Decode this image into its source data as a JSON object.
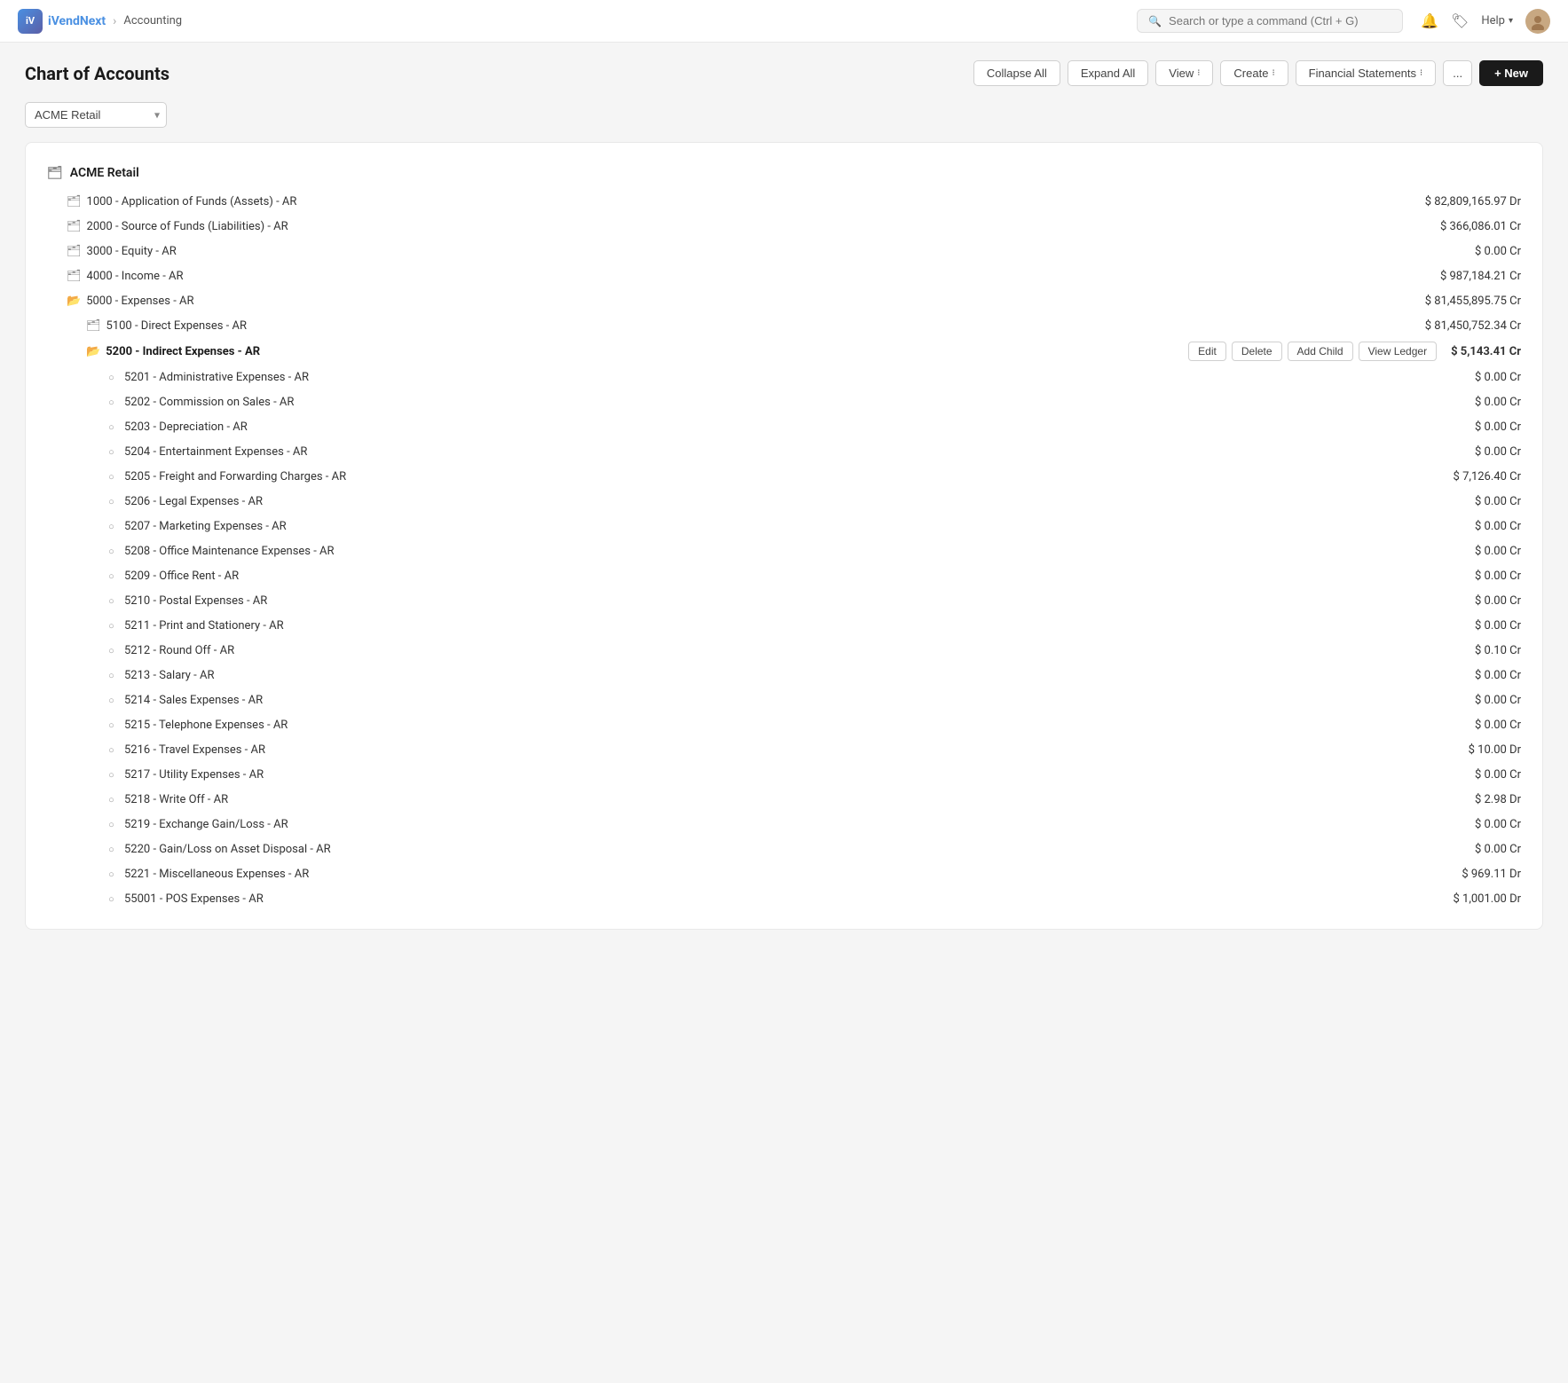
{
  "app": {
    "name": "iVendNext",
    "logo_text": "iV",
    "breadcrumb_separator": "›",
    "section": "Accounting"
  },
  "topnav": {
    "search_placeholder": "Search or type a command (Ctrl + G)",
    "help_label": "Help",
    "notification_icon": "🔔",
    "bookmark_icon": "🏷"
  },
  "page": {
    "title": "Chart of Accounts",
    "collapse_all": "Collapse All",
    "expand_all": "Expand All",
    "view_label": "View",
    "create_label": "Create",
    "financial_statements_label": "Financial Statements",
    "more_label": "...",
    "new_label": "+ New"
  },
  "company_selector": {
    "selected": "ACME Retail"
  },
  "tree": {
    "root": {
      "name": "ACME Retail",
      "icon": "root"
    },
    "accounts": [
      {
        "id": "1000",
        "name": "1000 - Application of Funds (Assets) - AR",
        "amount": "$ 82,809,165.97 Dr",
        "indent": 1,
        "icon": "folder",
        "bold": false,
        "active": false
      },
      {
        "id": "2000",
        "name": "2000 - Source of Funds (Liabilities) - AR",
        "amount": "$ 366,086.01 Cr",
        "indent": 1,
        "icon": "folder",
        "bold": false,
        "active": false
      },
      {
        "id": "3000",
        "name": "3000 - Equity - AR",
        "amount": "$ 0.00 Cr",
        "indent": 1,
        "icon": "folder",
        "bold": false,
        "active": false
      },
      {
        "id": "4000",
        "name": "4000 - Income - AR",
        "amount": "$ 987,184.21 Cr",
        "indent": 1,
        "icon": "folder",
        "bold": false,
        "active": false
      },
      {
        "id": "5000",
        "name": "5000 - Expenses - AR",
        "amount": "$ 81,455,895.75 Cr",
        "indent": 1,
        "icon": "folder-open",
        "bold": false,
        "active": false
      },
      {
        "id": "5100",
        "name": "5100 - Direct Expenses - AR",
        "amount": "$ 81,450,752.34 Cr",
        "indent": 2,
        "icon": "folder",
        "bold": false,
        "active": false
      },
      {
        "id": "5200",
        "name": "5200 - Indirect Expenses - AR",
        "amount": "$ 5,143.41 Cr",
        "indent": 2,
        "icon": "folder-open",
        "bold": true,
        "active": true,
        "context_actions": [
          "Edit",
          "Delete",
          "Add Child",
          "View Ledger"
        ]
      },
      {
        "id": "5201",
        "name": "5201 - Administrative Expenses - AR",
        "amount": "$ 0.00 Cr",
        "indent": 3,
        "icon": "circle",
        "bold": false,
        "active": false
      },
      {
        "id": "5202",
        "name": "5202 - Commission on Sales - AR",
        "amount": "$ 0.00 Cr",
        "indent": 3,
        "icon": "circle",
        "bold": false,
        "active": false
      },
      {
        "id": "5203",
        "name": "5203 - Depreciation - AR",
        "amount": "$ 0.00 Cr",
        "indent": 3,
        "icon": "circle",
        "bold": false,
        "active": false
      },
      {
        "id": "5204",
        "name": "5204 - Entertainment Expenses - AR",
        "amount": "$ 0.00 Cr",
        "indent": 3,
        "icon": "circle",
        "bold": false,
        "active": false
      },
      {
        "id": "5205",
        "name": "5205 - Freight and Forwarding Charges - AR",
        "amount": "$ 7,126.40 Cr",
        "indent": 3,
        "icon": "circle",
        "bold": false,
        "active": false
      },
      {
        "id": "5206",
        "name": "5206 - Legal Expenses - AR",
        "amount": "$ 0.00 Cr",
        "indent": 3,
        "icon": "circle",
        "bold": false,
        "active": false
      },
      {
        "id": "5207",
        "name": "5207 - Marketing Expenses - AR",
        "amount": "$ 0.00 Cr",
        "indent": 3,
        "icon": "circle",
        "bold": false,
        "active": false
      },
      {
        "id": "5208",
        "name": "5208 - Office Maintenance Expenses - AR",
        "amount": "$ 0.00 Cr",
        "indent": 3,
        "icon": "circle",
        "bold": false,
        "active": false
      },
      {
        "id": "5209",
        "name": "5209 - Office Rent - AR",
        "amount": "$ 0.00 Cr",
        "indent": 3,
        "icon": "circle",
        "bold": false,
        "active": false
      },
      {
        "id": "5210",
        "name": "5210 - Postal Expenses - AR",
        "amount": "$ 0.00 Cr",
        "indent": 3,
        "icon": "circle",
        "bold": false,
        "active": false
      },
      {
        "id": "5211",
        "name": "5211 - Print and Stationery - AR",
        "amount": "$ 0.00 Cr",
        "indent": 3,
        "icon": "circle",
        "bold": false,
        "active": false
      },
      {
        "id": "5212",
        "name": "5212 - Round Off - AR",
        "amount": "$ 0.10 Cr",
        "indent": 3,
        "icon": "circle",
        "bold": false,
        "active": false
      },
      {
        "id": "5213",
        "name": "5213 - Salary - AR",
        "amount": "$ 0.00 Cr",
        "indent": 3,
        "icon": "circle",
        "bold": false,
        "active": false
      },
      {
        "id": "5214",
        "name": "5214 - Sales Expenses - AR",
        "amount": "$ 0.00 Cr",
        "indent": 3,
        "icon": "circle",
        "bold": false,
        "active": false
      },
      {
        "id": "5215",
        "name": "5215 - Telephone Expenses - AR",
        "amount": "$ 0.00 Cr",
        "indent": 3,
        "icon": "circle",
        "bold": false,
        "active": false
      },
      {
        "id": "5216",
        "name": "5216 - Travel Expenses - AR",
        "amount": "$ 10.00 Dr",
        "indent": 3,
        "icon": "circle",
        "bold": false,
        "active": false
      },
      {
        "id": "5217",
        "name": "5217 - Utility Expenses - AR",
        "amount": "$ 0.00 Cr",
        "indent": 3,
        "icon": "circle",
        "bold": false,
        "active": false
      },
      {
        "id": "5218",
        "name": "5218 - Write Off - AR",
        "amount": "$ 2.98 Dr",
        "indent": 3,
        "icon": "circle",
        "bold": false,
        "active": false
      },
      {
        "id": "5219",
        "name": "5219 - Exchange Gain/Loss - AR",
        "amount": "$ 0.00 Cr",
        "indent": 3,
        "icon": "circle",
        "bold": false,
        "active": false
      },
      {
        "id": "5220",
        "name": "5220 - Gain/Loss on Asset Disposal - AR",
        "amount": "$ 0.00 Cr",
        "indent": 3,
        "icon": "circle",
        "bold": false,
        "active": false
      },
      {
        "id": "5221",
        "name": "5221 - Miscellaneous Expenses - AR",
        "amount": "$ 969.11 Dr",
        "indent": 3,
        "icon": "circle",
        "bold": false,
        "active": false
      },
      {
        "id": "55001",
        "name": "55001 - POS Expenses - AR",
        "amount": "$ 1,001.00 Dr",
        "indent": 3,
        "icon": "circle",
        "bold": false,
        "active": false
      }
    ],
    "context_action_labels": {
      "edit": "Edit",
      "delete": "Delete",
      "add_child": "Add Child",
      "view_ledger": "View Ledger"
    }
  }
}
